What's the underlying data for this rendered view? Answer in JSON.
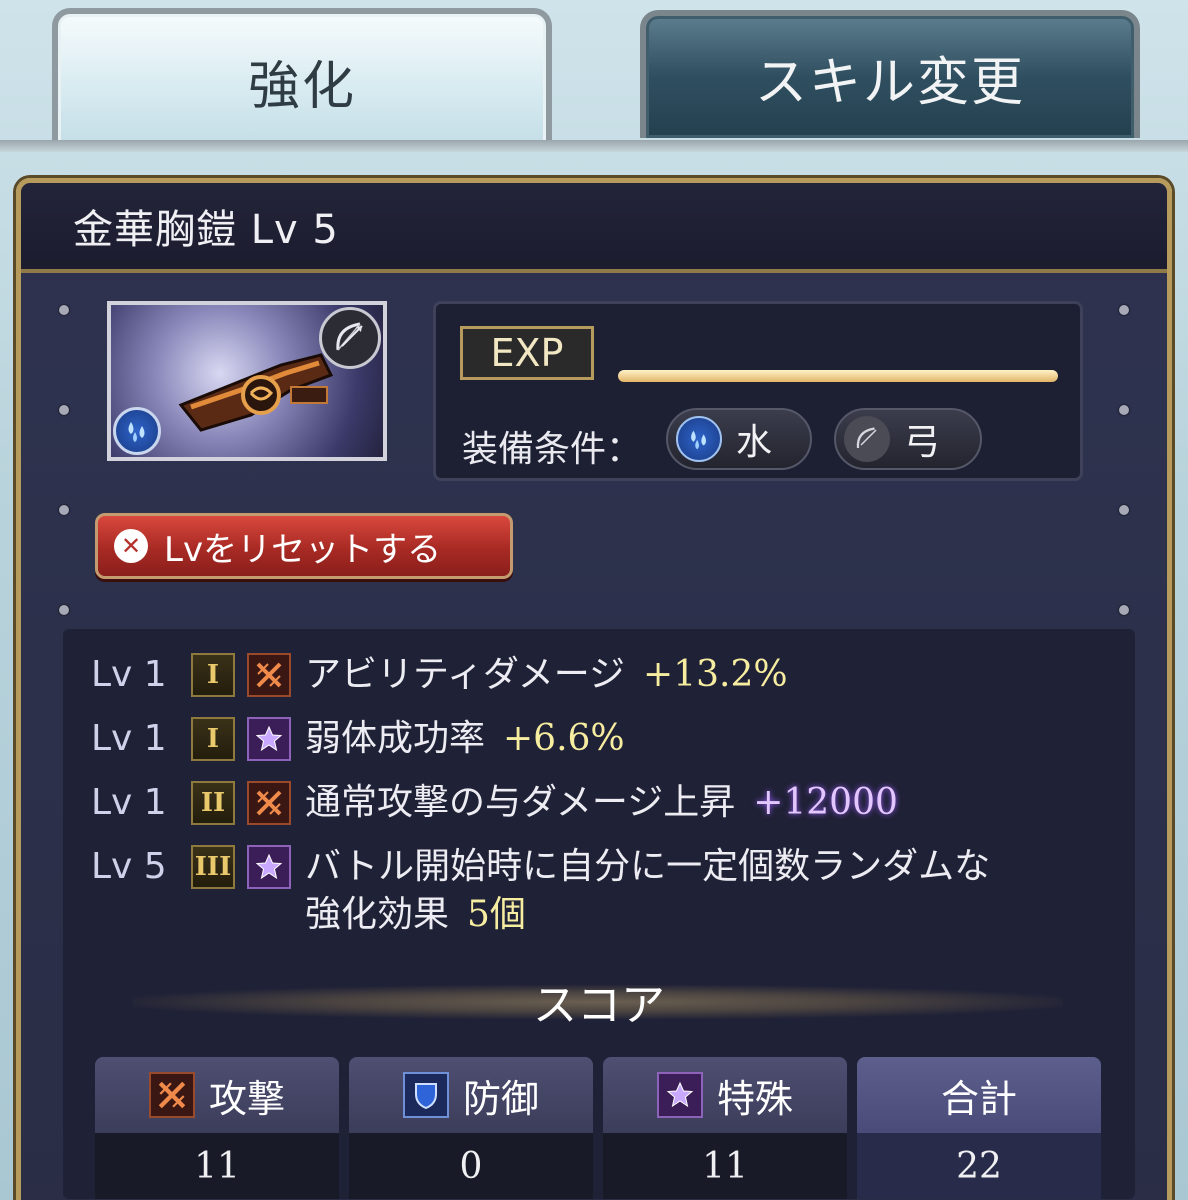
{
  "tabs": [
    {
      "label": "強化",
      "active": true
    },
    {
      "label": "スキル変更",
      "active": false
    }
  ],
  "item": {
    "title": "金華胸鎧 Lv 5",
    "image_icon": "armor-chestplate-icon",
    "weapon_icon": "bow-icon",
    "element_icon": "water-element-icon"
  },
  "exp": {
    "label": "EXP",
    "progress": 1.0
  },
  "equip": {
    "label": "装備条件：",
    "conditions": [
      {
        "label": "水",
        "icon": "water-element-icon"
      },
      {
        "label": "弓",
        "icon": "bow-icon"
      }
    ]
  },
  "reset_button": {
    "label": "Lvをリセットする",
    "icon": "close-icon"
  },
  "skills": [
    {
      "lv": "Lv 1",
      "rank": "I",
      "type": "attack-icon",
      "name": "アビリティダメージ",
      "value": "+13.2%"
    },
    {
      "lv": "Lv 1",
      "rank": "I",
      "type": "special-star-icon",
      "name": "弱体成功率",
      "value": "+6.6%"
    },
    {
      "lv": "Lv 1",
      "rank": "II",
      "type": "attack-icon",
      "name": "通常攻撃の与ダメージ上昇",
      "value": "+12000"
    },
    {
      "lv": "Lv 5",
      "rank": "III",
      "type": "special-star-icon",
      "name_line1": "バトル開始時に自分に一定個数ランダムな",
      "name_line2": "強化効果",
      "value": "5個"
    }
  ],
  "score": {
    "title": "スコア",
    "columns": [
      {
        "label": "攻撃",
        "icon": "attack-icon",
        "value": "11"
      },
      {
        "label": "防御",
        "icon": "shield-icon",
        "value": "0"
      },
      {
        "label": "特殊",
        "icon": "special-star-icon",
        "value": "11"
      },
      {
        "label": "合計",
        "icon": "",
        "value": "22"
      }
    ]
  },
  "colors": {
    "gold_border": "#b69b5d",
    "panel_bg": "#2e3350",
    "reset_red": "#b5302a",
    "value_yellow": "#f7eda0",
    "value_purple": "#e4c6ff"
  }
}
